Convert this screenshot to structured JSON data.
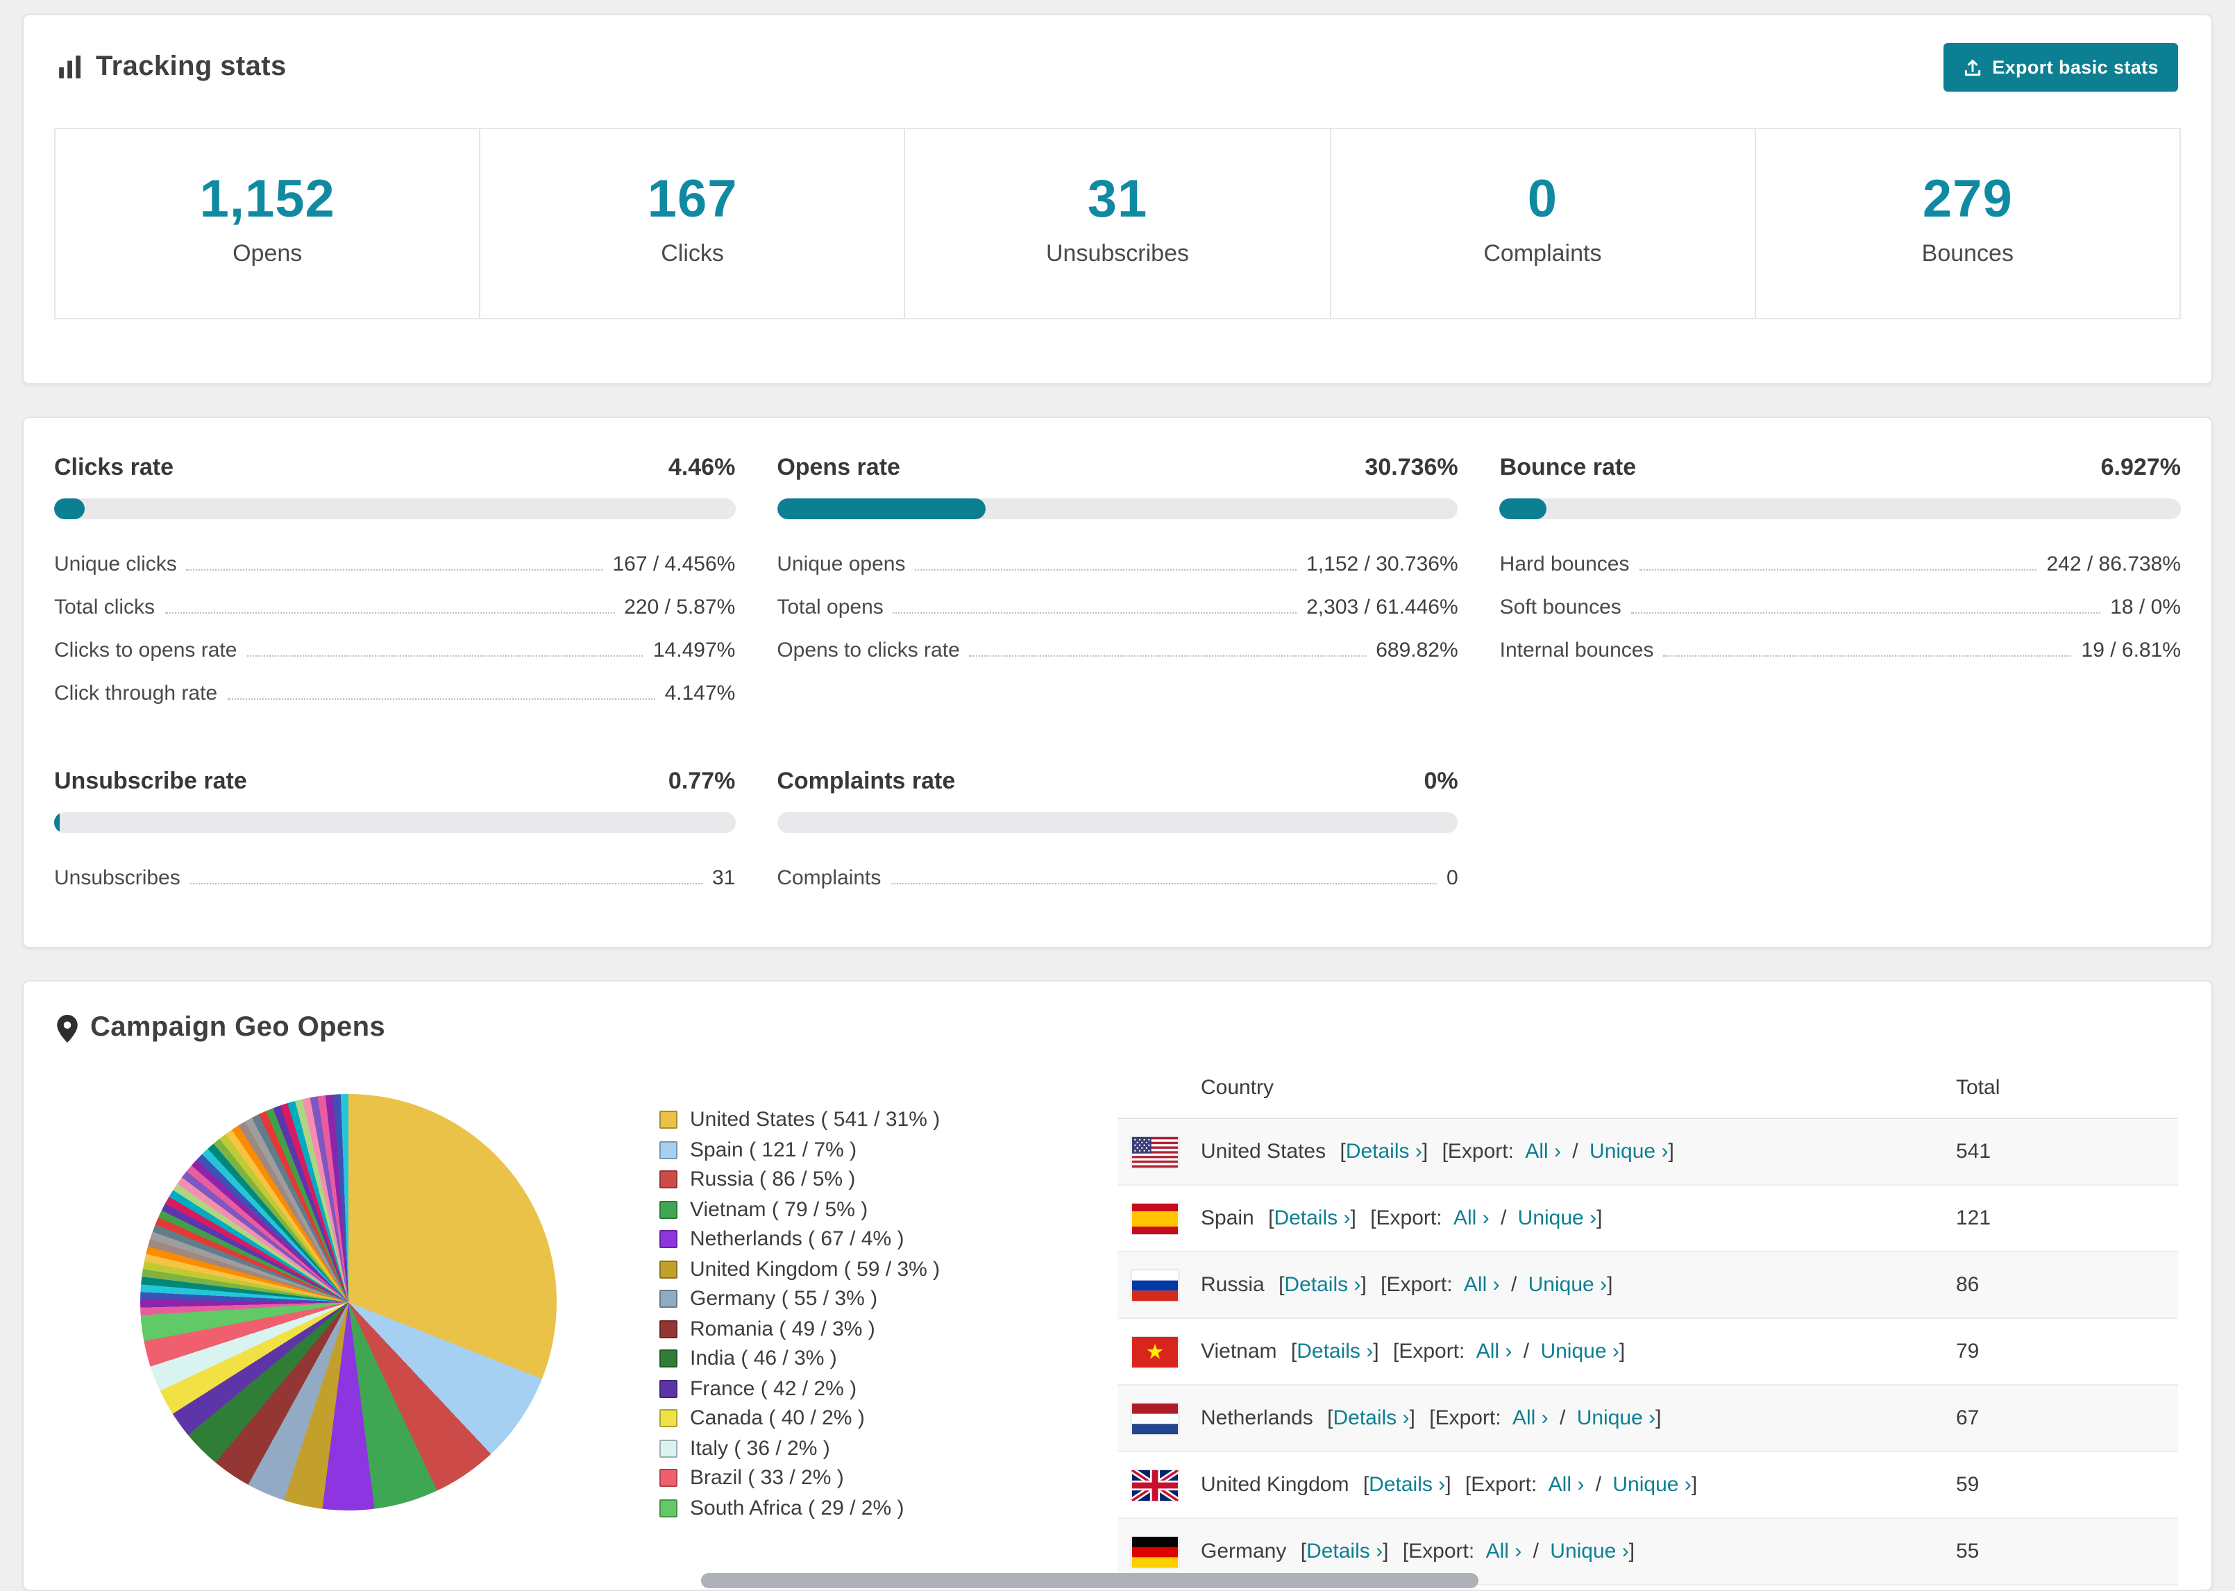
{
  "colors": {
    "accent": "#0d7f92",
    "stat_number": "#1089a2"
  },
  "tracking": {
    "title": "Tracking stats",
    "export_label": "Export basic stats",
    "stats": [
      {
        "value": "1,152",
        "label": "Opens"
      },
      {
        "value": "167",
        "label": "Clicks"
      },
      {
        "value": "31",
        "label": "Unsubscribes"
      },
      {
        "value": "0",
        "label": "Complaints"
      },
      {
        "value": "279",
        "label": "Bounces"
      }
    ]
  },
  "rates": [
    {
      "title": "Clicks rate",
      "value": "4.46%",
      "percent": 4.46,
      "rows": [
        {
          "label": "Unique clicks",
          "value": "167 / 4.456%"
        },
        {
          "label": "Total clicks",
          "value": "220 / 5.87%"
        },
        {
          "label": "Clicks to opens rate",
          "value": "14.497%"
        },
        {
          "label": "Click through rate",
          "value": "4.147%"
        }
      ]
    },
    {
      "title": "Opens rate",
      "value": "30.736%",
      "percent": 30.736,
      "rows": [
        {
          "label": "Unique opens",
          "value": "1,152 / 30.736%"
        },
        {
          "label": "Total opens",
          "value": "2,303 / 61.446%"
        },
        {
          "label": "Opens to clicks rate",
          "value": "689.82%"
        }
      ]
    },
    {
      "title": "Bounce rate",
      "value": "6.927%",
      "percent": 6.927,
      "rows": [
        {
          "label": "Hard bounces",
          "value": "242 / 86.738%"
        },
        {
          "label": "Soft bounces",
          "value": "18 / 0%"
        },
        {
          "label": "Internal bounces",
          "value": "19 / 6.81%"
        }
      ]
    },
    {
      "title": "Unsubscribe rate",
      "value": "0.77%",
      "percent": 0.77,
      "rows": [
        {
          "label": "Unsubscribes",
          "value": "31"
        }
      ]
    },
    {
      "title": "Complaints rate",
      "value": "0%",
      "percent": 0,
      "rows": [
        {
          "label": "Complaints",
          "value": "0"
        }
      ]
    }
  ],
  "geo": {
    "title": "Campaign Geo Opens",
    "chart_data": {
      "type": "pie",
      "title": "Campaign Geo Opens",
      "slices": [
        {
          "label": "United States",
          "value": 541,
          "percent": 31,
          "color": "#e9c247"
        },
        {
          "label": "Spain",
          "value": 121,
          "percent": 7,
          "color": "#a6d0f1"
        },
        {
          "label": "Russia",
          "value": 86,
          "percent": 5,
          "color": "#cc4b48"
        },
        {
          "label": "Vietnam",
          "value": 79,
          "percent": 5,
          "color": "#3fa754"
        },
        {
          "label": "Netherlands",
          "value": 67,
          "percent": 4,
          "color": "#8c35e0"
        },
        {
          "label": "United Kingdom",
          "value": 59,
          "percent": 3,
          "color": "#c2a02b"
        },
        {
          "label": "Germany",
          "value": 55,
          "percent": 3,
          "color": "#93aac4"
        },
        {
          "label": "Romania",
          "value": 49,
          "percent": 3,
          "color": "#943634"
        },
        {
          "label": "India",
          "value": 46,
          "percent": 3,
          "color": "#2f7d36"
        },
        {
          "label": "France",
          "value": 42,
          "percent": 2,
          "color": "#5e35a8"
        },
        {
          "label": "Canada",
          "value": 40,
          "percent": 2,
          "color": "#f2e143"
        },
        {
          "label": "Italy",
          "value": 36,
          "percent": 2,
          "color": "#d9f3f1"
        },
        {
          "label": "Brazil",
          "value": 33,
          "percent": 2,
          "color": "#ef5f6e"
        },
        {
          "label": "South Africa",
          "value": 29,
          "percent": 2,
          "color": "#61c966"
        }
      ],
      "others_percent": 26,
      "others_count": 44,
      "others_palette": [
        "#e85d9e",
        "#8e24aa",
        "#3f51b5",
        "#26c6da",
        "#00897b",
        "#7cb342",
        "#c0ca33",
        "#f6c344",
        "#fb8c00",
        "#a1887f",
        "#9e9e9e",
        "#607d8b",
        "#e53935",
        "#43a047",
        "#5e35b1",
        "#d81b60",
        "#00acc1",
        "#aed581",
        "#f48fb1",
        "#7e57c2"
      ]
    },
    "table": {
      "headers": [
        "Country",
        "Total"
      ],
      "bo": "[",
      "bc": "]",
      "details_label": "Details",
      "export_prefix": "Export:",
      "all_label": "All",
      "unique_label": "Unique",
      "slash": "/",
      "chevron": "›",
      "rows": [
        {
          "country": "United States",
          "total": "541",
          "flag": "us"
        },
        {
          "country": "Spain",
          "total": "121",
          "flag": "es"
        },
        {
          "country": "Russia",
          "total": "86",
          "flag": "ru"
        },
        {
          "country": "Vietnam",
          "total": "79",
          "flag": "vn"
        },
        {
          "country": "Netherlands",
          "total": "67",
          "flag": "nl"
        },
        {
          "country": "United Kingdom",
          "total": "59",
          "flag": "gb"
        },
        {
          "country": "Germany",
          "total": "55",
          "flag": "de"
        }
      ]
    }
  }
}
